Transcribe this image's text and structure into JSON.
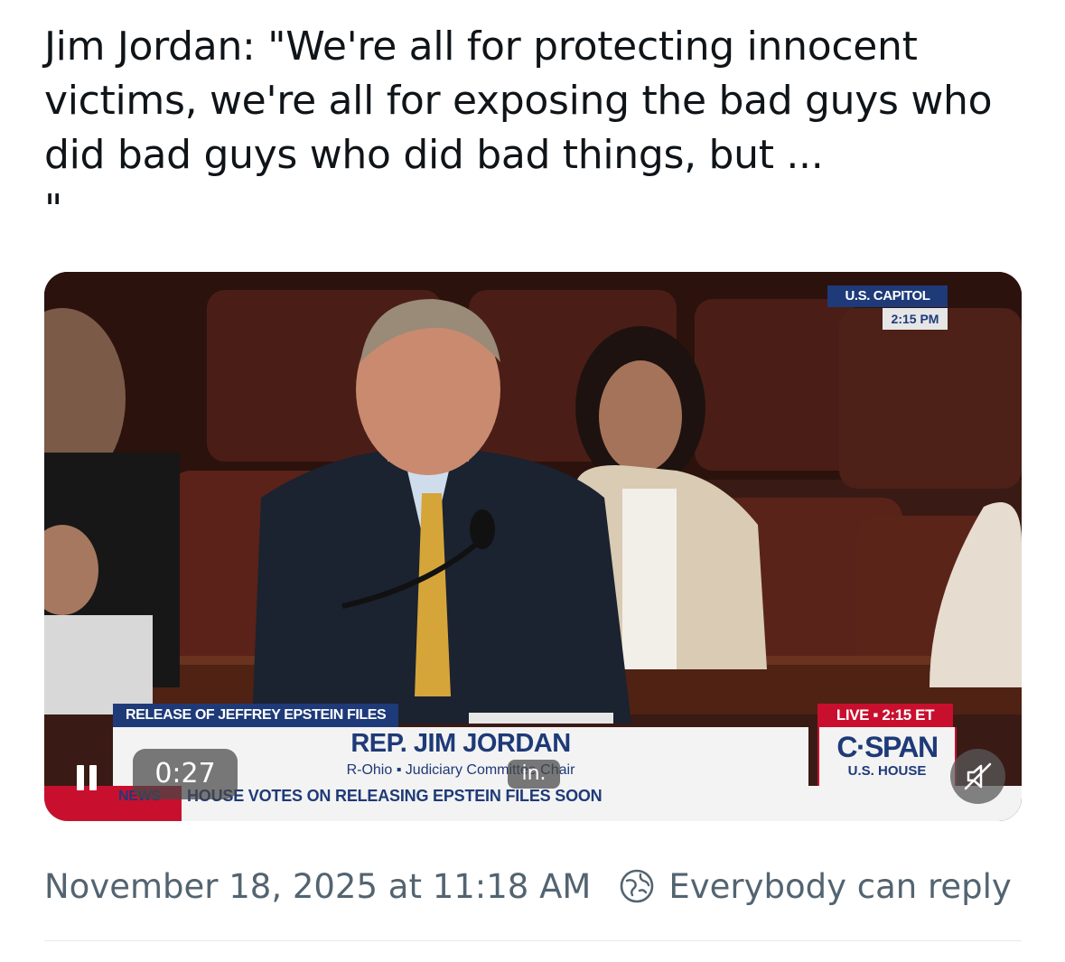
{
  "post": {
    "text": "Jim Jordan: \"We're all for protecting innocent victims, we're all for exposing the bad guys who did bad guys who did bad things, but ...\n\""
  },
  "video": {
    "overlay": {
      "topic": "RELEASE OF JEFFREY EPSTEIN FILES",
      "name": "REP. JIM JORDAN",
      "subtitle": "R-Ohio  ▪  Judiciary Committee Chair",
      "news_label": "NEWS",
      "ticker": "HOUSE VOTES ON RELEASING EPSTEIN FILES SOON",
      "network_logo": "C·SPAN",
      "network_sub": "U.S. HOUSE",
      "live_label": "LIVE  ▪  2:15 ET",
      "location": "U.S. CAPITOL",
      "location_time": "2:15 PM"
    },
    "controls": {
      "elapsed": "0:27",
      "caption_fragment": "in.",
      "playing": true,
      "muted": true,
      "icons": {
        "pause": "pause-icon",
        "mute": "speaker-muted-icon"
      }
    }
  },
  "meta": {
    "timestamp": "November 18, 2025 at 11:18 AM",
    "reply_setting": "Everybody can reply",
    "reply_icon": "globe-reply-icon"
  },
  "colors": {
    "text_primary": "#0f1419",
    "text_secondary": "#536471",
    "cspan_blue": "#1e3a78",
    "cspan_red": "#c8102e"
  }
}
